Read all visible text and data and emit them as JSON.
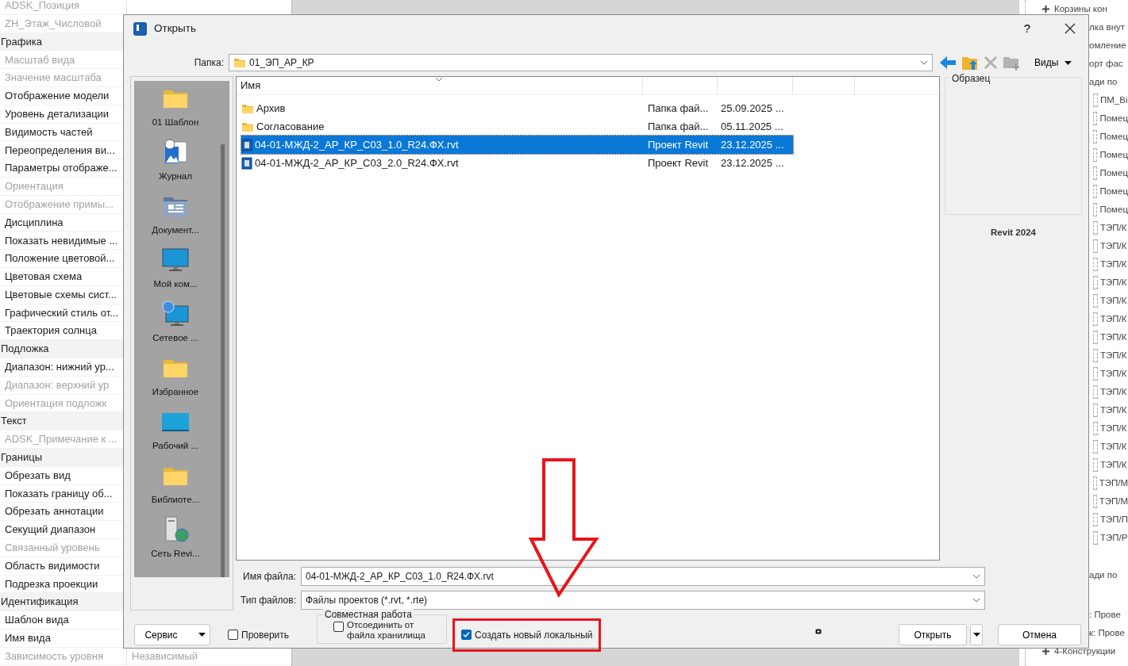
{
  "properties": [
    {
      "kind": "item",
      "label": "ADSK_Позиция",
      "disabled": true
    },
    {
      "kind": "item",
      "label": "ZH_Этаж_Числовой",
      "disabled": true
    },
    {
      "kind": "header",
      "label": "Графика"
    },
    {
      "kind": "item",
      "label": "Масштаб вида",
      "disabled": true
    },
    {
      "kind": "item",
      "label": "Значение масштаба",
      "disabled": true
    },
    {
      "kind": "item",
      "label": "Отображение модели",
      "disabled": false
    },
    {
      "kind": "item",
      "label": "Уровень детализации",
      "disabled": false
    },
    {
      "kind": "item",
      "label": "Видимость частей",
      "disabled": false
    },
    {
      "kind": "item",
      "label": "Переопределения ви...",
      "disabled": false
    },
    {
      "kind": "item",
      "label": "Параметры отображе...",
      "disabled": false
    },
    {
      "kind": "item",
      "label": "Ориентация",
      "disabled": true
    },
    {
      "kind": "item",
      "label": "Отображение примы...",
      "disabled": true
    },
    {
      "kind": "item",
      "label": "Дисциплина",
      "disabled": false
    },
    {
      "kind": "item",
      "label": "Показать невидимые ...",
      "disabled": false
    },
    {
      "kind": "item",
      "label": "Положение цветовой...",
      "disabled": false
    },
    {
      "kind": "item",
      "label": "Цветовая схема",
      "disabled": false
    },
    {
      "kind": "item",
      "label": "Цветовые схемы сист...",
      "disabled": false
    },
    {
      "kind": "item",
      "label": "Графический стиль от...",
      "disabled": false
    },
    {
      "kind": "item",
      "label": "Траектория солнца",
      "disabled": false
    },
    {
      "kind": "header",
      "label": "Подложка"
    },
    {
      "kind": "item",
      "label": "Диапазон: нижний ур...",
      "disabled": false
    },
    {
      "kind": "item",
      "label": "Диапазон: верхний ур",
      "disabled": true
    },
    {
      "kind": "item",
      "label": "Ориентация подложк",
      "disabled": true
    },
    {
      "kind": "header",
      "label": "Текст"
    },
    {
      "kind": "item",
      "label": "ADSK_Примечание к ...",
      "disabled": true
    },
    {
      "kind": "header",
      "label": "Границы"
    },
    {
      "kind": "item",
      "label": "Обрезать вид",
      "disabled": false
    },
    {
      "kind": "item",
      "label": "Показать границу об...",
      "disabled": false
    },
    {
      "kind": "item",
      "label": "Обрезать аннотации",
      "disabled": false
    },
    {
      "kind": "item",
      "label": "Секущий диапазон",
      "disabled": false
    },
    {
      "kind": "item",
      "label": "Связанный уровень",
      "disabled": true
    },
    {
      "kind": "item",
      "label": "Область видимости",
      "disabled": false
    },
    {
      "kind": "item",
      "label": "Подрезка проекции",
      "disabled": false
    },
    {
      "kind": "header",
      "label": "Идентификация"
    },
    {
      "kind": "item",
      "label": "Шаблон вида",
      "disabled": false
    },
    {
      "kind": "item",
      "label": "Имя вида",
      "disabled": false
    },
    {
      "kind": "item",
      "label": "Зависимость уровня",
      "disabled": true,
      "value": "Независимый"
    }
  ],
  "browser": [
    {
      "kind": "expander",
      "label": "Корзины кон"
    },
    {
      "kind": "node",
      "label": "лка внут"
    },
    {
      "kind": "node",
      "label": "омление"
    },
    {
      "kind": "node",
      "label": "орт фас"
    },
    {
      "kind": "node",
      "label": "ади по",
      "children": [
        {
          "label": "ПМ_Ві"
        },
        {
          "label": "Помец"
        },
        {
          "label": "Помец"
        },
        {
          "label": "Помец"
        },
        {
          "label": "Помец"
        },
        {
          "label": "Помец"
        },
        {
          "label": "Помец"
        },
        {
          "label": "ТЭП/К"
        },
        {
          "label": "ТЭП/К"
        },
        {
          "label": "ТЭП/К"
        },
        {
          "label": "ТЭП/К"
        },
        {
          "label": "ТЭП/К"
        },
        {
          "label": "ТЭП/К"
        },
        {
          "label": "ТЭП/К"
        },
        {
          "label": "ТЭП/К"
        },
        {
          "label": "ТЭП/К"
        },
        {
          "label": "ТЭП/К"
        },
        {
          "label": "ТЭП/К"
        },
        {
          "label": "ТЭП/К"
        },
        {
          "label": "ТЭП/К"
        },
        {
          "label": "ТЭП/К"
        },
        {
          "label": "ТЭП/М"
        },
        {
          "label": "ТЭП/М"
        },
        {
          "label": "ТЭП/П"
        },
        {
          "label": "ТЭП/Р"
        }
      ]
    },
    {
      "kind": "node",
      "label": "ади по"
    },
    {
      "kind": "node",
      "label": ": Прове"
    },
    {
      "kind": "node",
      "label": "к: Прове"
    },
    {
      "kind": "expander",
      "label": "4-Конструкции"
    }
  ],
  "dialog": {
    "title": "Открыть",
    "help": "?",
    "folder": {
      "label": "Папка:",
      "value": "01_ЭП_АР_КР"
    },
    "toolbar": [
      {
        "kind": "back",
        "disabled": false
      },
      {
        "kind": "up",
        "disabled": false
      },
      {
        "kind": "delete",
        "disabled": true
      },
      {
        "kind": "new_folder",
        "disabled": true
      }
    ],
    "views": "Виды",
    "places": [
      {
        "kind": "folder",
        "label": "01 Шаблон"
      },
      {
        "kind": "history",
        "label": "Журнал"
      },
      {
        "kind": "documents",
        "label": "Документ..."
      },
      {
        "kind": "computer",
        "label": "Мой ком..."
      },
      {
        "kind": "network",
        "label": "Сетевое ..."
      },
      {
        "kind": "folder",
        "label": "Избранное"
      },
      {
        "kind": "desktop",
        "label": "Рабочий ..."
      },
      {
        "kind": "folder",
        "label": "Библиоте..."
      },
      {
        "kind": "server",
        "label": "Сеть Revi..."
      }
    ],
    "file_list": {
      "columns": [
        "Имя"
      ],
      "rows": [
        {
          "kind": "folder",
          "name": "Архив",
          "type": "Папка фай...",
          "date": "25.09.2025 ...",
          "selected": false
        },
        {
          "kind": "folder",
          "name": "Согласование",
          "type": "Папка фай...",
          "date": "05.11.2025 ...",
          "selected": false
        },
        {
          "kind": "project",
          "name": "04-01-МЖД-2_АР_КР_С03_1.0_R24.ФХ.rvt",
          "type": "Проект Revit",
          "date": "23.12.2025 ...",
          "selected": true
        },
        {
          "kind": "project",
          "name": "04-01-МЖД-2_АР_КР_С03_2.0_R24.ФХ.rvt",
          "type": "Проект Revit",
          "date": "23.12.2025 ...",
          "selected": false
        }
      ]
    },
    "preview": {
      "title": "Образец",
      "caption": "Revit 2024"
    },
    "file_name": {
      "label": "Имя файла:",
      "value": "04-01-МЖД-2_АР_КР_С03_1.0_R24.ФХ.rvt"
    },
    "file_type": {
      "label": "Тип файлов:",
      "value": "Файлы проектов  (*.rvt, *.rte)"
    },
    "tools_button": "Сервис",
    "audit": {
      "label": "Проверить",
      "checked": false
    },
    "worksharing": {
      "title": "Совместная работа",
      "detach": {
        "label": "Отсоединить от файла хранилища",
        "checked": false
      },
      "create_local": {
        "label": "Создать новый локальный",
        "checked": true
      }
    },
    "open_button": "Открыть",
    "cancel_button": "Отмена"
  },
  "annotations": {
    "arrow": true,
    "highlight_frame": true
  }
}
